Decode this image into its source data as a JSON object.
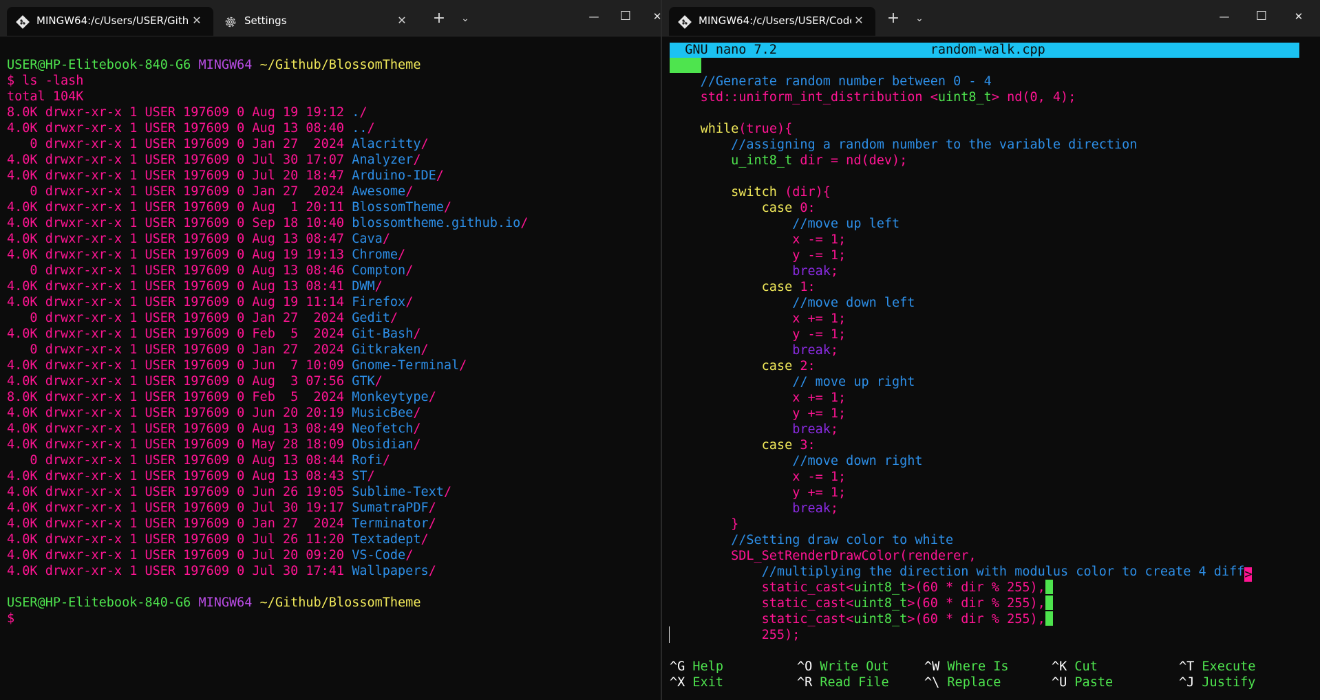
{
  "left": {
    "tabs": [
      {
        "title": "MINGW64:/c/Users/USER/Githu",
        "active": true,
        "icon": "git-bash-icon"
      },
      {
        "title": "Settings",
        "active": false,
        "icon": "gear-icon"
      }
    ],
    "new_tab": "+",
    "dropdown": "⌄",
    "window_controls": {
      "minimize": "—",
      "maximize": "☐",
      "close": "✕"
    },
    "prompt1": {
      "user": "USER@HP-Elitebook-840-G6",
      "env": "MINGW64",
      "path": "~/Github/BlossomTheme"
    },
    "command": "$ ls -lash",
    "total": "total 104K",
    "entries": [
      {
        "meta": "8.0K drwxr-xr-x 1 USER 197609 0 Aug 19 19:12 ",
        "name": ".",
        "slash": "/"
      },
      {
        "meta": "4.0K drwxr-xr-x 1 USER 197609 0 Aug 13 08:40 ",
        "name": "..",
        "slash": "/"
      },
      {
        "meta": "   0 drwxr-xr-x 1 USER 197609 0 Jan 27  2024 ",
        "name": "Alacritty",
        "slash": "/"
      },
      {
        "meta": "4.0K drwxr-xr-x 1 USER 197609 0 Jul 30 17:07 ",
        "name": "Analyzer",
        "slash": "/"
      },
      {
        "meta": "4.0K drwxr-xr-x 1 USER 197609 0 Jul 20 18:47 ",
        "name": "Arduino-IDE",
        "slash": "/"
      },
      {
        "meta": "   0 drwxr-xr-x 1 USER 197609 0 Jan 27  2024 ",
        "name": "Awesome",
        "slash": "/"
      },
      {
        "meta": "4.0K drwxr-xr-x 1 USER 197609 0 Aug  1 20:11 ",
        "name": "BlossomTheme",
        "slash": "/"
      },
      {
        "meta": "4.0K drwxr-xr-x 1 USER 197609 0 Sep 18 10:40 ",
        "name": "blossomtheme.github.io",
        "slash": "/"
      },
      {
        "meta": "4.0K drwxr-xr-x 1 USER 197609 0 Aug 13 08:47 ",
        "name": "Cava",
        "slash": "/"
      },
      {
        "meta": "4.0K drwxr-xr-x 1 USER 197609 0 Aug 19 19:13 ",
        "name": "Chrome",
        "slash": "/"
      },
      {
        "meta": "   0 drwxr-xr-x 1 USER 197609 0 Aug 13 08:46 ",
        "name": "Compton",
        "slash": "/"
      },
      {
        "meta": "4.0K drwxr-xr-x 1 USER 197609 0 Aug 13 08:41 ",
        "name": "DWM",
        "slash": "/"
      },
      {
        "meta": "4.0K drwxr-xr-x 1 USER 197609 0 Aug 19 11:14 ",
        "name": "Firefox",
        "slash": "/"
      },
      {
        "meta": "   0 drwxr-xr-x 1 USER 197609 0 Jan 27  2024 ",
        "name": "Gedit",
        "slash": "/"
      },
      {
        "meta": "4.0K drwxr-xr-x 1 USER 197609 0 Feb  5  2024 ",
        "name": "Git-Bash",
        "slash": "/"
      },
      {
        "meta": "   0 drwxr-xr-x 1 USER 197609 0 Jan 27  2024 ",
        "name": "Gitkraken",
        "slash": "/"
      },
      {
        "meta": "4.0K drwxr-xr-x 1 USER 197609 0 Jun  7 10:09 ",
        "name": "Gnome-Terminal",
        "slash": "/"
      },
      {
        "meta": "4.0K drwxr-xr-x 1 USER 197609 0 Aug  3 07:56 ",
        "name": "GTK",
        "slash": "/"
      },
      {
        "meta": "8.0K drwxr-xr-x 1 USER 197609 0 Feb  5  2024 ",
        "name": "Monkeytype",
        "slash": "/"
      },
      {
        "meta": "4.0K drwxr-xr-x 1 USER 197609 0 Jun 20 20:19 ",
        "name": "MusicBee",
        "slash": "/"
      },
      {
        "meta": "4.0K drwxr-xr-x 1 USER 197609 0 Aug 13 08:49 ",
        "name": "Neofetch",
        "slash": "/"
      },
      {
        "meta": "4.0K drwxr-xr-x 1 USER 197609 0 May 28 18:09 ",
        "name": "Obsidian",
        "slash": "/"
      },
      {
        "meta": "   0 drwxr-xr-x 1 USER 197609 0 Aug 13 08:44 ",
        "name": "Rofi",
        "slash": "/"
      },
      {
        "meta": "4.0K drwxr-xr-x 1 USER 197609 0 Aug 13 08:43 ",
        "name": "ST",
        "slash": "/"
      },
      {
        "meta": "4.0K drwxr-xr-x 1 USER 197609 0 Jun 26 19:05 ",
        "name": "Sublime-Text",
        "slash": "/"
      },
      {
        "meta": "4.0K drwxr-xr-x 1 USER 197609 0 Jul 30 19:17 ",
        "name": "SumatraPDF",
        "slash": "/"
      },
      {
        "meta": "4.0K drwxr-xr-x 1 USER 197609 0 Jan 27  2024 ",
        "name": "Terminator",
        "slash": "/"
      },
      {
        "meta": "4.0K drwxr-xr-x 1 USER 197609 0 Jul 26 11:20 ",
        "name": "Textadept",
        "slash": "/"
      },
      {
        "meta": "4.0K drwxr-xr-x 1 USER 197609 0 Jul 20 09:20 ",
        "name": "VS-Code",
        "slash": "/"
      },
      {
        "meta": "4.0K drwxr-xr-x 1 USER 197609 0 Jul 30 17:41 ",
        "name": "Wallpapers",
        "slash": "/"
      }
    ],
    "prompt2": {
      "user": "USER@HP-Elitebook-840-G6",
      "env": "MINGW64",
      "path": "~/Github/BlossomTheme"
    },
    "cursor_prompt": "$"
  },
  "right": {
    "tabs": [
      {
        "title": "MINGW64:/c/Users/USER/Code",
        "active": true,
        "icon": "git-bash-icon"
      }
    ],
    "new_tab": "+",
    "dropdown": "⌄",
    "window_controls": {
      "minimize": "—",
      "maximize": "☐",
      "close": "✕"
    },
    "nano_title": "  GNU nano 7.2                    random-walk.cpp",
    "code_lines": [
      [
        {
          "t": "    ",
          "c": "w"
        },
        {
          "t": "//Generate random number between 0 - 4",
          "c": "b"
        }
      ],
      [
        {
          "t": "    ",
          "c": "w"
        },
        {
          "t": "std::uniform_int_distribution ",
          "c": "pk"
        },
        {
          "t": "<",
          "c": "pk"
        },
        {
          "t": "uint8_t",
          "c": "g"
        },
        {
          "t": "> nd(0, 4);",
          "c": "pk"
        }
      ],
      [
        {
          "t": "",
          "c": "w"
        }
      ],
      [
        {
          "t": "    ",
          "c": "w"
        },
        {
          "t": "while",
          "c": "y"
        },
        {
          "t": "(true){",
          "c": "pk"
        }
      ],
      [
        {
          "t": "        ",
          "c": "w"
        },
        {
          "t": "//assigning a random number to the variable direction",
          "c": "b"
        }
      ],
      [
        {
          "t": "        ",
          "c": "w"
        },
        {
          "t": "u_int8_t",
          "c": "g"
        },
        {
          "t": " dir = nd(dev);",
          "c": "pk"
        }
      ],
      [
        {
          "t": "",
          "c": "w"
        }
      ],
      [
        {
          "t": "        ",
          "c": "w"
        },
        {
          "t": "switch",
          "c": "y"
        },
        {
          "t": " (dir){",
          "c": "pk"
        }
      ],
      [
        {
          "t": "            ",
          "c": "w"
        },
        {
          "t": "case",
          "c": "y"
        },
        {
          "t": " 0:",
          "c": "pk"
        }
      ],
      [
        {
          "t": "                ",
          "c": "w"
        },
        {
          "t": "//move up left",
          "c": "b"
        }
      ],
      [
        {
          "t": "                ",
          "c": "w"
        },
        {
          "t": "x -= 1;",
          "c": "pk"
        }
      ],
      [
        {
          "t": "                ",
          "c": "w"
        },
        {
          "t": "y -= 1;",
          "c": "pk"
        }
      ],
      [
        {
          "t": "                ",
          "c": "w"
        },
        {
          "t": "break",
          "c": "v"
        },
        {
          "t": ";",
          "c": "pk"
        }
      ],
      [
        {
          "t": "            ",
          "c": "w"
        },
        {
          "t": "case",
          "c": "y"
        },
        {
          "t": " 1:",
          "c": "pk"
        }
      ],
      [
        {
          "t": "                ",
          "c": "w"
        },
        {
          "t": "//move down left",
          "c": "b"
        }
      ],
      [
        {
          "t": "                ",
          "c": "w"
        },
        {
          "t": "x += 1;",
          "c": "pk"
        }
      ],
      [
        {
          "t": "                ",
          "c": "w"
        },
        {
          "t": "y -= 1;",
          "c": "pk"
        }
      ],
      [
        {
          "t": "                ",
          "c": "w"
        },
        {
          "t": "break",
          "c": "v"
        },
        {
          "t": ";",
          "c": "pk"
        }
      ],
      [
        {
          "t": "            ",
          "c": "w"
        },
        {
          "t": "case",
          "c": "y"
        },
        {
          "t": " 2:",
          "c": "pk"
        }
      ],
      [
        {
          "t": "                ",
          "c": "w"
        },
        {
          "t": "// move up right",
          "c": "b"
        }
      ],
      [
        {
          "t": "                ",
          "c": "w"
        },
        {
          "t": "x += 1;",
          "c": "pk"
        }
      ],
      [
        {
          "t": "                ",
          "c": "w"
        },
        {
          "t": "y += 1;",
          "c": "pk"
        }
      ],
      [
        {
          "t": "                ",
          "c": "w"
        },
        {
          "t": "break",
          "c": "v"
        },
        {
          "t": ";",
          "c": "pk"
        }
      ],
      [
        {
          "t": "            ",
          "c": "w"
        },
        {
          "t": "case",
          "c": "y"
        },
        {
          "t": " 3:",
          "c": "pk"
        }
      ],
      [
        {
          "t": "                ",
          "c": "w"
        },
        {
          "t": "//move down right",
          "c": "b"
        }
      ],
      [
        {
          "t": "                ",
          "c": "w"
        },
        {
          "t": "x -= 1;",
          "c": "pk"
        }
      ],
      [
        {
          "t": "                ",
          "c": "w"
        },
        {
          "t": "y += 1;",
          "c": "pk"
        }
      ],
      [
        {
          "t": "                ",
          "c": "w"
        },
        {
          "t": "break",
          "c": "v"
        },
        {
          "t": ";",
          "c": "pk"
        }
      ],
      [
        {
          "t": "        ",
          "c": "w"
        },
        {
          "t": "}",
          "c": "pk"
        }
      ],
      [
        {
          "t": "        ",
          "c": "w"
        },
        {
          "t": "//Setting draw color to white",
          "c": "b"
        }
      ],
      [
        {
          "t": "        ",
          "c": "w"
        },
        {
          "t": "SDL_SetRenderDrawColor(renderer,",
          "c": "pk"
        }
      ],
      [
        {
          "t": "            ",
          "c": "w"
        },
        {
          "t": "//multiplying the direction with modulus color to create 4 diff",
          "c": "b"
        },
        {
          "t": ">",
          "c": "pkblock"
        }
      ],
      [
        {
          "t": "            ",
          "c": "w"
        },
        {
          "t": "static_cast<",
          "c": "pk"
        },
        {
          "t": "uint8_t",
          "c": "g"
        },
        {
          "t": ">(60 * dir % 255),",
          "c": "pk"
        },
        {
          "t": "",
          "c": "gblock"
        }
      ],
      [
        {
          "t": "            ",
          "c": "w"
        },
        {
          "t": "static_cast<",
          "c": "pk"
        },
        {
          "t": "uint8_t",
          "c": "g"
        },
        {
          "t": ">(60 * dir % 255),",
          "c": "pk"
        },
        {
          "t": "",
          "c": "gblock"
        }
      ],
      [
        {
          "t": "            ",
          "c": "w"
        },
        {
          "t": "static_cast<",
          "c": "pk"
        },
        {
          "t": "uint8_t",
          "c": "g"
        },
        {
          "t": ">(60 * dir % 255),",
          "c": "pk"
        },
        {
          "t": "",
          "c": "gblock"
        }
      ],
      [
        {
          "t": "            ",
          "c": "w"
        },
        {
          "t": "255);",
          "c": "pk"
        }
      ]
    ],
    "shortcuts": [
      [
        {
          "key": "^G",
          "label": "Help"
        },
        {
          "key": "^O",
          "label": "Write Out"
        },
        {
          "key": "^W",
          "label": "Where Is"
        },
        {
          "key": "^K",
          "label": "Cut"
        },
        {
          "key": "^T",
          "label": "Execute"
        }
      ],
      [
        {
          "key": "^X",
          "label": "Exit"
        },
        {
          "key": "^R",
          "label": "Read File"
        },
        {
          "key": "^\\",
          "label": "Replace"
        },
        {
          "key": "^U",
          "label": "Paste"
        },
        {
          "key": "^J",
          "label": "Justify"
        }
      ]
    ]
  }
}
